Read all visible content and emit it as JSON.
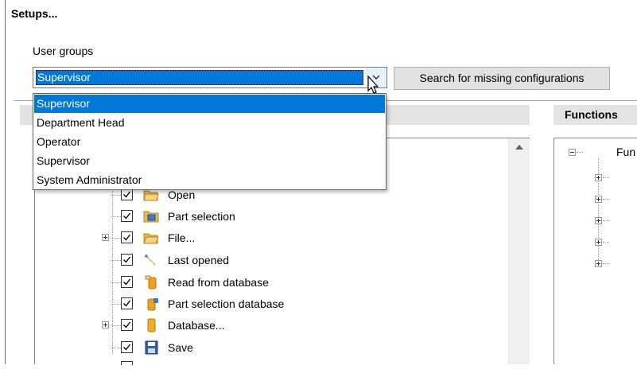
{
  "dialog": {
    "title": "Setups..."
  },
  "user_groups": {
    "label": "User groups",
    "selected_value": "Supervisor",
    "options": [
      "Supervisor",
      "Department Head",
      "Operator",
      "Supervisor",
      "System Administrator"
    ],
    "highlighted_index": 0
  },
  "search_button": {
    "label": "Search for missing configurations"
  },
  "functions_panel": {
    "title": "Functions",
    "root_label": "Fun"
  },
  "tree_items": [
    {
      "label": "Open",
      "checked": true,
      "expandable": false,
      "icon": "open-folder-icon"
    },
    {
      "label": "Part selection",
      "checked": true,
      "expandable": false,
      "icon": "part-selection-icon"
    },
    {
      "label": "File...",
      "checked": true,
      "expandable": true,
      "icon": "file-folder-icon"
    },
    {
      "label": "Last opened",
      "checked": true,
      "expandable": false,
      "icon": "last-opened-icon"
    },
    {
      "label": "Read from database",
      "checked": true,
      "expandable": false,
      "icon": "read-database-icon"
    },
    {
      "label": "Part selection database",
      "checked": true,
      "expandable": false,
      "icon": "part-selection-database-icon"
    },
    {
      "label": "Database...",
      "checked": true,
      "expandable": true,
      "icon": "database-icon"
    },
    {
      "label": "Save",
      "checked": true,
      "expandable": false,
      "icon": "save-disk-icon"
    }
  ],
  "colors": {
    "selection": "#0078d7",
    "header_bg": "#e3e3e3"
  }
}
